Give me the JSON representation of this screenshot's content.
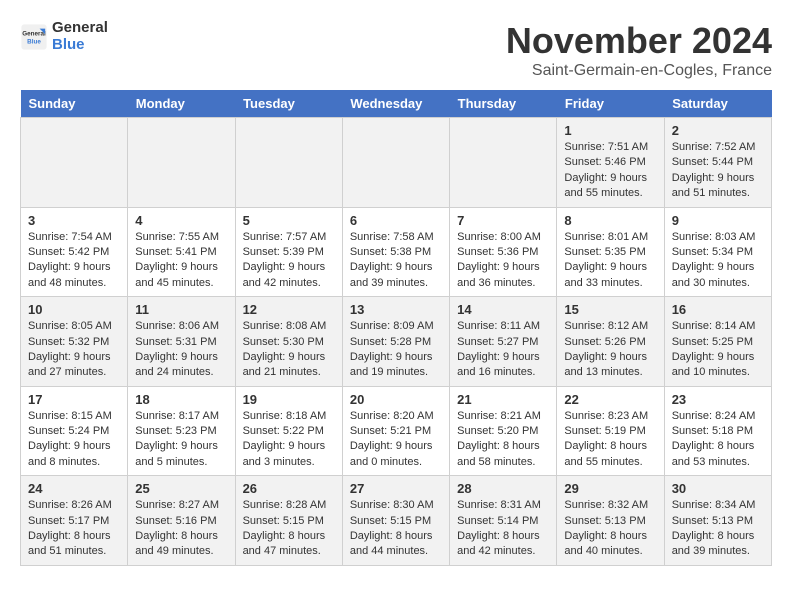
{
  "logo": {
    "general": "General",
    "blue": "Blue"
  },
  "title": "November 2024",
  "location": "Saint-Germain-en-Cogles, France",
  "days_header": [
    "Sunday",
    "Monday",
    "Tuesday",
    "Wednesday",
    "Thursday",
    "Friday",
    "Saturday"
  ],
  "weeks": [
    [
      {
        "day": "",
        "info": ""
      },
      {
        "day": "",
        "info": ""
      },
      {
        "day": "",
        "info": ""
      },
      {
        "day": "",
        "info": ""
      },
      {
        "day": "",
        "info": ""
      },
      {
        "day": "1",
        "info": "Sunrise: 7:51 AM\nSunset: 5:46 PM\nDaylight: 9 hours and 55 minutes."
      },
      {
        "day": "2",
        "info": "Sunrise: 7:52 AM\nSunset: 5:44 PM\nDaylight: 9 hours and 51 minutes."
      }
    ],
    [
      {
        "day": "3",
        "info": "Sunrise: 7:54 AM\nSunset: 5:42 PM\nDaylight: 9 hours and 48 minutes."
      },
      {
        "day": "4",
        "info": "Sunrise: 7:55 AM\nSunset: 5:41 PM\nDaylight: 9 hours and 45 minutes."
      },
      {
        "day": "5",
        "info": "Sunrise: 7:57 AM\nSunset: 5:39 PM\nDaylight: 9 hours and 42 minutes."
      },
      {
        "day": "6",
        "info": "Sunrise: 7:58 AM\nSunset: 5:38 PM\nDaylight: 9 hours and 39 minutes."
      },
      {
        "day": "7",
        "info": "Sunrise: 8:00 AM\nSunset: 5:36 PM\nDaylight: 9 hours and 36 minutes."
      },
      {
        "day": "8",
        "info": "Sunrise: 8:01 AM\nSunset: 5:35 PM\nDaylight: 9 hours and 33 minutes."
      },
      {
        "day": "9",
        "info": "Sunrise: 8:03 AM\nSunset: 5:34 PM\nDaylight: 9 hours and 30 minutes."
      }
    ],
    [
      {
        "day": "10",
        "info": "Sunrise: 8:05 AM\nSunset: 5:32 PM\nDaylight: 9 hours and 27 minutes."
      },
      {
        "day": "11",
        "info": "Sunrise: 8:06 AM\nSunset: 5:31 PM\nDaylight: 9 hours and 24 minutes."
      },
      {
        "day": "12",
        "info": "Sunrise: 8:08 AM\nSunset: 5:30 PM\nDaylight: 9 hours and 21 minutes."
      },
      {
        "day": "13",
        "info": "Sunrise: 8:09 AM\nSunset: 5:28 PM\nDaylight: 9 hours and 19 minutes."
      },
      {
        "day": "14",
        "info": "Sunrise: 8:11 AM\nSunset: 5:27 PM\nDaylight: 9 hours and 16 minutes."
      },
      {
        "day": "15",
        "info": "Sunrise: 8:12 AM\nSunset: 5:26 PM\nDaylight: 9 hours and 13 minutes."
      },
      {
        "day": "16",
        "info": "Sunrise: 8:14 AM\nSunset: 5:25 PM\nDaylight: 9 hours and 10 minutes."
      }
    ],
    [
      {
        "day": "17",
        "info": "Sunrise: 8:15 AM\nSunset: 5:24 PM\nDaylight: 9 hours and 8 minutes."
      },
      {
        "day": "18",
        "info": "Sunrise: 8:17 AM\nSunset: 5:23 PM\nDaylight: 9 hours and 5 minutes."
      },
      {
        "day": "19",
        "info": "Sunrise: 8:18 AM\nSunset: 5:22 PM\nDaylight: 9 hours and 3 minutes."
      },
      {
        "day": "20",
        "info": "Sunrise: 8:20 AM\nSunset: 5:21 PM\nDaylight: 9 hours and 0 minutes."
      },
      {
        "day": "21",
        "info": "Sunrise: 8:21 AM\nSunset: 5:20 PM\nDaylight: 8 hours and 58 minutes."
      },
      {
        "day": "22",
        "info": "Sunrise: 8:23 AM\nSunset: 5:19 PM\nDaylight: 8 hours and 55 minutes."
      },
      {
        "day": "23",
        "info": "Sunrise: 8:24 AM\nSunset: 5:18 PM\nDaylight: 8 hours and 53 minutes."
      }
    ],
    [
      {
        "day": "24",
        "info": "Sunrise: 8:26 AM\nSunset: 5:17 PM\nDaylight: 8 hours and 51 minutes."
      },
      {
        "day": "25",
        "info": "Sunrise: 8:27 AM\nSunset: 5:16 PM\nDaylight: 8 hours and 49 minutes."
      },
      {
        "day": "26",
        "info": "Sunrise: 8:28 AM\nSunset: 5:15 PM\nDaylight: 8 hours and 47 minutes."
      },
      {
        "day": "27",
        "info": "Sunrise: 8:30 AM\nSunset: 5:15 PM\nDaylight: 8 hours and 44 minutes."
      },
      {
        "day": "28",
        "info": "Sunrise: 8:31 AM\nSunset: 5:14 PM\nDaylight: 8 hours and 42 minutes."
      },
      {
        "day": "29",
        "info": "Sunrise: 8:32 AM\nSunset: 5:13 PM\nDaylight: 8 hours and 40 minutes."
      },
      {
        "day": "30",
        "info": "Sunrise: 8:34 AM\nSunset: 5:13 PM\nDaylight: 8 hours and 39 minutes."
      }
    ]
  ]
}
